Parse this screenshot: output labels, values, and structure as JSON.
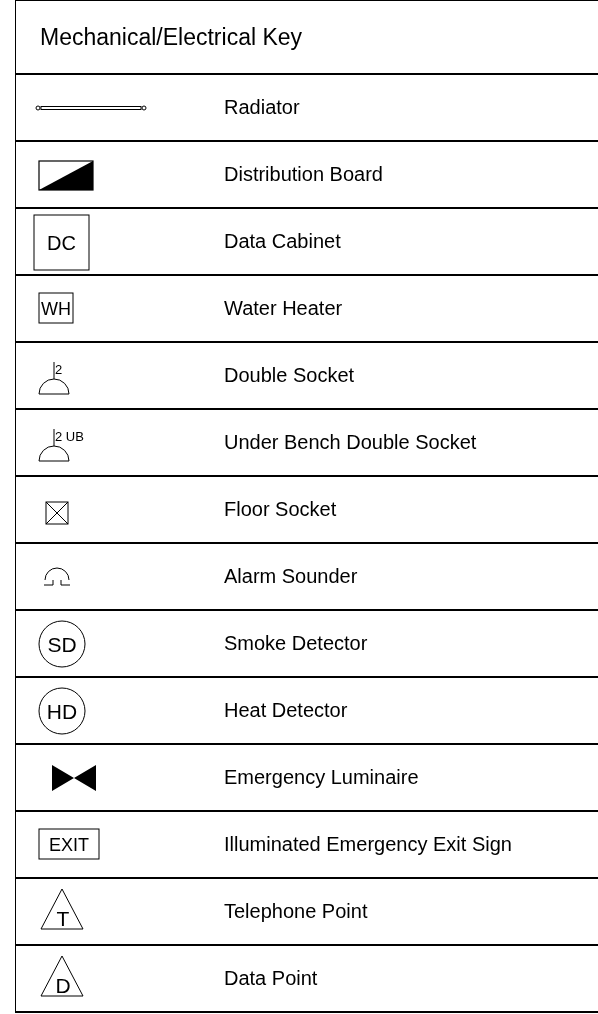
{
  "title": "Mechanical/Electrical Key",
  "rows": [
    {
      "kind": "radiator",
      "label": "Radiator"
    },
    {
      "kind": "distribution_board",
      "label": "Distribution Board"
    },
    {
      "kind": "large_box",
      "symbol_text": "DC",
      "label": "Data Cabinet"
    },
    {
      "kind": "box",
      "symbol_text": "WH",
      "label": "Water Heater"
    },
    {
      "kind": "socket",
      "symbol_text": "2",
      "label": "Double Socket"
    },
    {
      "kind": "socket",
      "symbol_text": "2 UB",
      "label": "Under Bench Double Socket"
    },
    {
      "kind": "floor_socket",
      "label": "Floor Socket"
    },
    {
      "kind": "sounder",
      "label": "Alarm Sounder"
    },
    {
      "kind": "circle",
      "symbol_text": "SD",
      "label": "Smoke Detector"
    },
    {
      "kind": "circle",
      "symbol_text": "HD",
      "label": "Heat Detector"
    },
    {
      "kind": "luminaire",
      "label": "Emergency Luminaire"
    },
    {
      "kind": "box",
      "symbol_text": "EXIT",
      "label": "Illuminated Emergency Exit Sign"
    },
    {
      "kind": "triangle",
      "symbol_text": "T",
      "label": "Telephone Point"
    },
    {
      "kind": "triangle",
      "symbol_text": "D",
      "label": "Data Point"
    }
  ]
}
